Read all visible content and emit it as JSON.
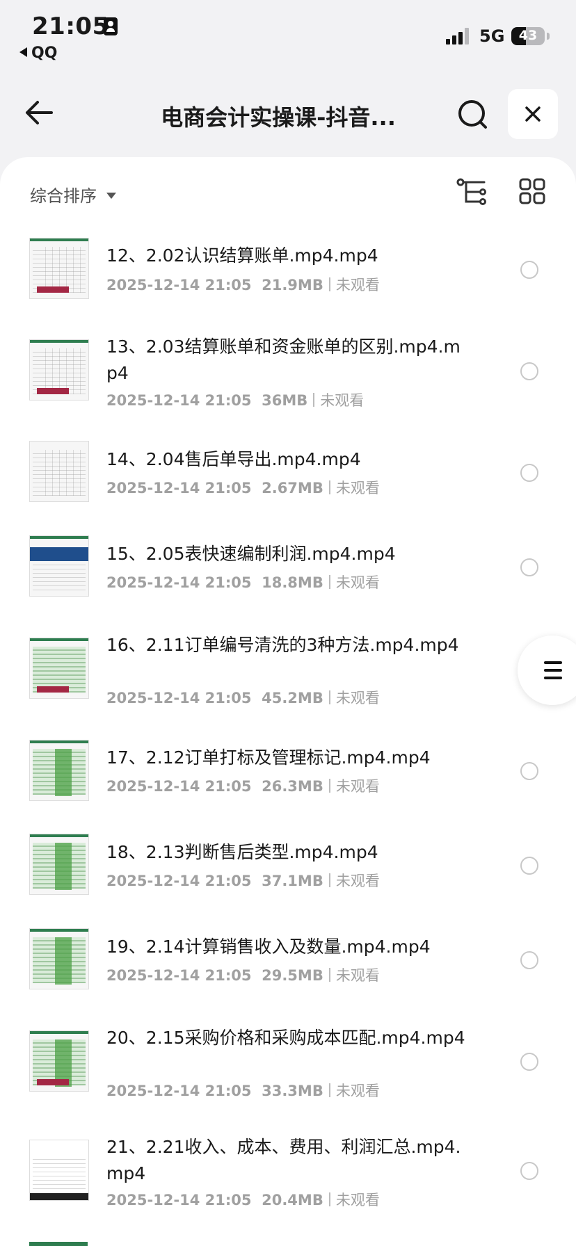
{
  "status_bar": {
    "time": "21:05",
    "back_app": "QQ",
    "network": "5G",
    "battery": "43",
    "battery_level": 0.43
  },
  "nav": {
    "title": "电商会计实操课-抖音..."
  },
  "toolbar": {
    "sort_label": "综合排序"
  },
  "files": [
    {
      "name": "12、2.02认识结算账单.mp4.mp4",
      "date": "2025-12-14 21:05",
      "size": "21.9MB",
      "status": "未观看"
    },
    {
      "name": "13、2.03结算账单和资金账单的区别.mp4.mp4",
      "date": "2025-12-14 21:05",
      "size": "36MB",
      "status": "未观看"
    },
    {
      "name": "14、2.04售后单导出.mp4.mp4",
      "date": "2025-12-14 21:05",
      "size": "2.67MB",
      "status": "未观看"
    },
    {
      "name": "15、2.05表快速编制利润.mp4.mp4",
      "date": "2025-12-14 21:05",
      "size": "18.8MB",
      "status": "未观看"
    },
    {
      "name": "16、2.11订单编号清洗的3种方法.mp4.mp4",
      "date": "2025-12-14 21:05",
      "size": "45.2MB",
      "status": "未观看"
    },
    {
      "name": "17、2.12订单打标及管理标记.mp4.mp4",
      "date": "2025-12-14 21:05",
      "size": "26.3MB",
      "status": "未观看"
    },
    {
      "name": "18、2.13判断售后类型.mp4.mp4",
      "date": "2025-12-14 21:05",
      "size": "37.1MB",
      "status": "未观看"
    },
    {
      "name": "19、2.14计算销售收入及数量.mp4.mp4",
      "date": "2025-12-14 21:05",
      "size": "29.5MB",
      "status": "未观看"
    },
    {
      "name": "20、2.15采购价格和采购成本匹配.mp4.mp4",
      "date": "2025-12-14 21:05",
      "size": "33.3MB",
      "status": "未观看"
    },
    {
      "name": "21、2.21收入、成本、费用、利润汇总.mp4.mp4",
      "date": "2025-12-14 21:05",
      "size": "20.4MB",
      "status": "未观看"
    }
  ]
}
